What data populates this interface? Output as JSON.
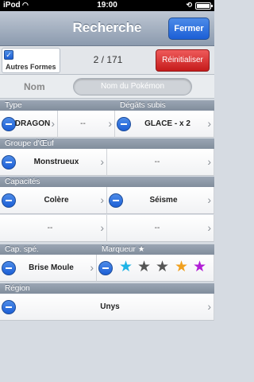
{
  "statusbar": {
    "carrier": "iPod",
    "time": "19:00"
  },
  "navbar": {
    "title": "Recherche",
    "close_label": "Fermer"
  },
  "toolbar": {
    "other_forms_label": "Autres Formes",
    "other_forms_checked": true,
    "count": "2 / 171",
    "reset_label": "Réinitialiser"
  },
  "name": {
    "label": "Nom",
    "placeholder": "Nom du Pokémon"
  },
  "sections": {
    "type": "Type",
    "damage": "Dégâts subis",
    "egg_group": "Groupe d'Œuf",
    "abilities": "Capacités",
    "special_ability": "Cap. spé.",
    "marker": "Marqueur ★",
    "region": "Région"
  },
  "filters": {
    "type1": "DRAGON",
    "type2": "--",
    "damage": "GLACE - x 2",
    "egg1": "Monstrueux",
    "egg2": "--",
    "ability1": "Colère",
    "ability2": "Séisme",
    "ability3": "--",
    "ability4": "--",
    "special_ability": "Brise Moule",
    "region": "Unys"
  },
  "markers": {
    "colors": [
      "#1fb4e6",
      "#555555",
      "#555555",
      "#f0a01e",
      "#b21fd6"
    ]
  }
}
